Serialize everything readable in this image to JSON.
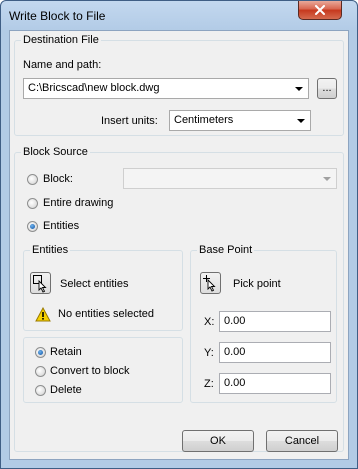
{
  "window": {
    "title": "Write Block to File"
  },
  "destination": {
    "group_title": "Destination File",
    "name_label": "Name and path:",
    "path_value": "C:\\Bricscad\\new block.dwg",
    "browse_label": "...",
    "insert_units_label": "Insert units:",
    "insert_units_value": "Centimeters"
  },
  "block_source": {
    "group_title": "Block Source",
    "block_label": "Block:",
    "block_value": "",
    "entire_drawing_label": "Entire drawing",
    "entities_label": "Entities",
    "selected": "entities"
  },
  "entities": {
    "group_title": "Entities",
    "select_label": "Select entities",
    "status_text": "No entities selected",
    "retain_label": "Retain",
    "convert_label": "Convert to block",
    "delete_label": "Delete",
    "selected_mode": "retain"
  },
  "base_point": {
    "group_title": "Base Point",
    "pick_label": "Pick point",
    "x_label": "X:",
    "x_value": "0.00",
    "y_label": "Y:",
    "y_value": "0.00",
    "z_label": "Z:",
    "z_value": "0.00"
  },
  "buttons": {
    "ok": "OK",
    "cancel": "Cancel"
  },
  "icons": {
    "close": "close-icon",
    "select_entities": "select-cursor-icon",
    "warning": "warning-icon",
    "pick_point": "pick-point-icon"
  },
  "colors": {
    "accent": "#1f63b1",
    "close_button": "#c6381d",
    "warning": "#f5d100"
  }
}
